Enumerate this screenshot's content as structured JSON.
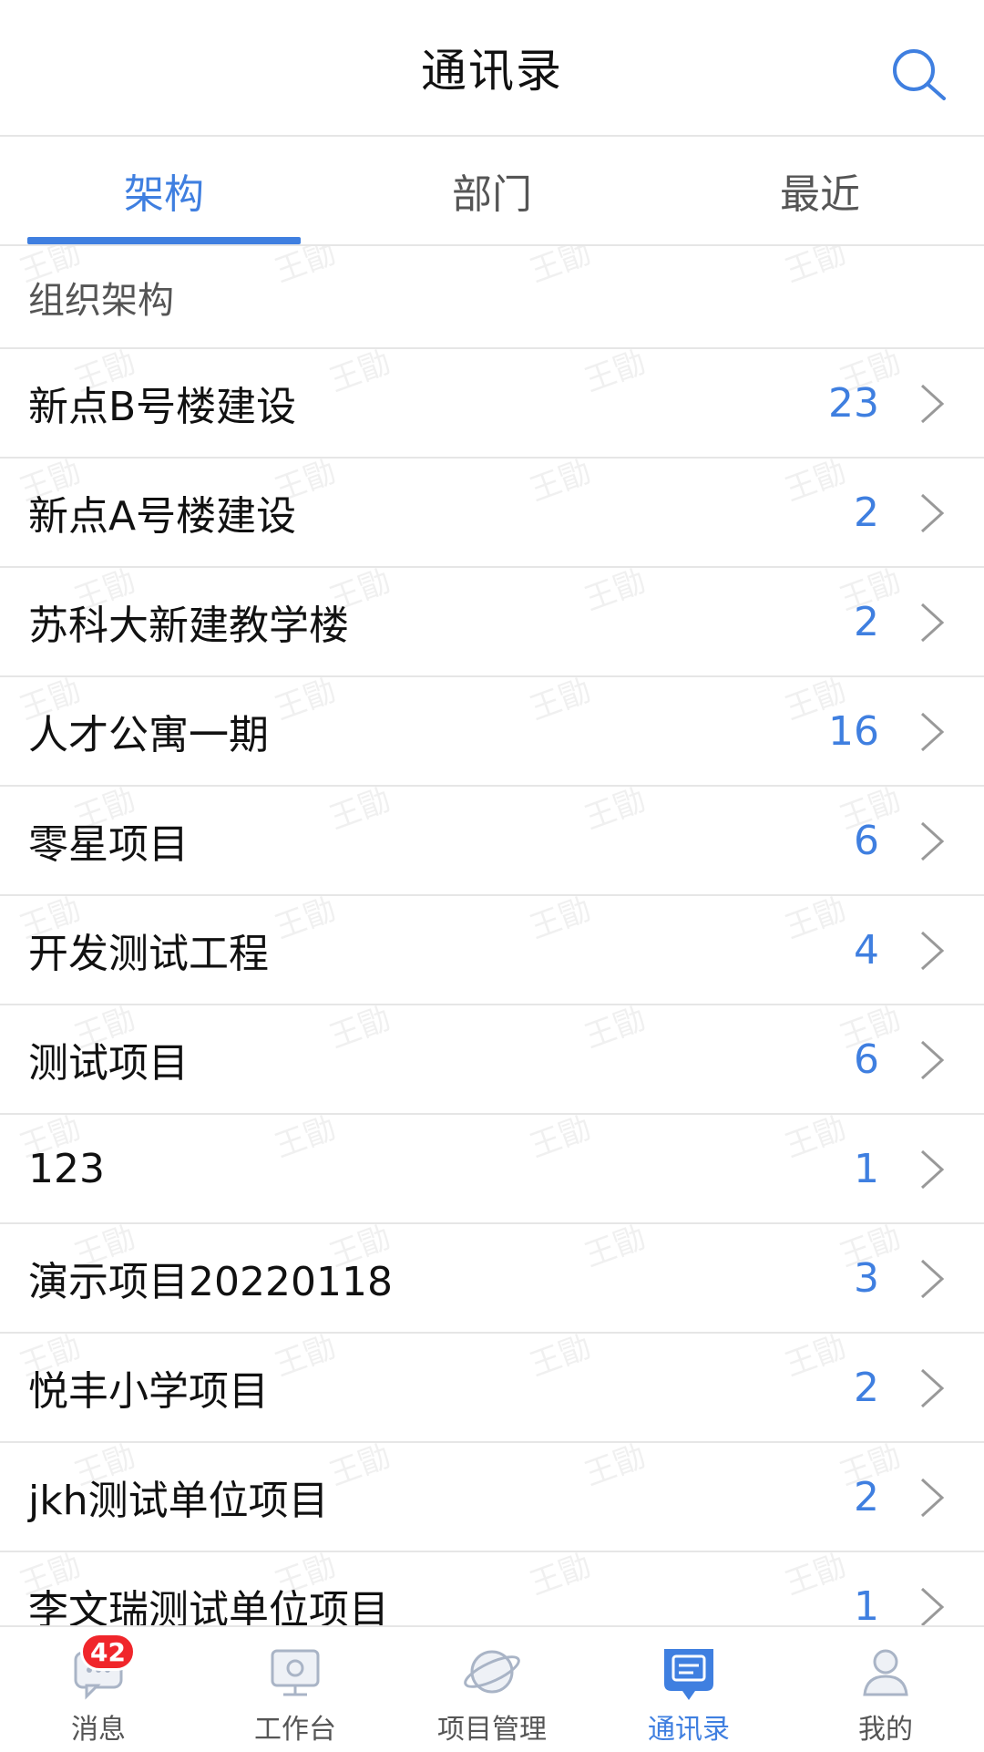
{
  "header": {
    "title": "通讯录",
    "search_icon": "search-icon"
  },
  "tabs": [
    {
      "label": "架构",
      "active": true
    },
    {
      "label": "部门",
      "active": false
    },
    {
      "label": "最近",
      "active": false
    }
  ],
  "section": {
    "label": "组织架构"
  },
  "list": [
    {
      "name": "新点B号楼建设",
      "count": "23"
    },
    {
      "name": "新点A号楼建设",
      "count": "2"
    },
    {
      "name": "苏科大新建教学楼",
      "count": "2"
    },
    {
      "name": "人才公寓一期",
      "count": "16"
    },
    {
      "name": "零星项目",
      "count": "6"
    },
    {
      "name": "开发测试工程",
      "count": "4"
    },
    {
      "name": "测试项目",
      "count": "6"
    },
    {
      "name": "123",
      "count": "1"
    },
    {
      "name": "演示项目20220118",
      "count": "3"
    },
    {
      "name": "悦丰小学项目",
      "count": "2"
    },
    {
      "name": "jkh测试单位项目",
      "count": "2"
    },
    {
      "name": "李文瑞测试单位项目",
      "count": "1"
    }
  ],
  "watermark": "王勖",
  "bottom_nav": {
    "items": [
      {
        "label": "消息",
        "icon": "message-icon",
        "badge": "42"
      },
      {
        "label": "工作台",
        "icon": "workbench-icon"
      },
      {
        "label": "项目管理",
        "icon": "project-management-icon"
      },
      {
        "label": "通讯录",
        "icon": "contacts-icon",
        "active": true
      },
      {
        "label": "我的",
        "icon": "profile-icon"
      }
    ]
  },
  "colors": {
    "accent": "#3f7fe0",
    "badge": "#f0262b",
    "divider": "#e6e6e6"
  }
}
